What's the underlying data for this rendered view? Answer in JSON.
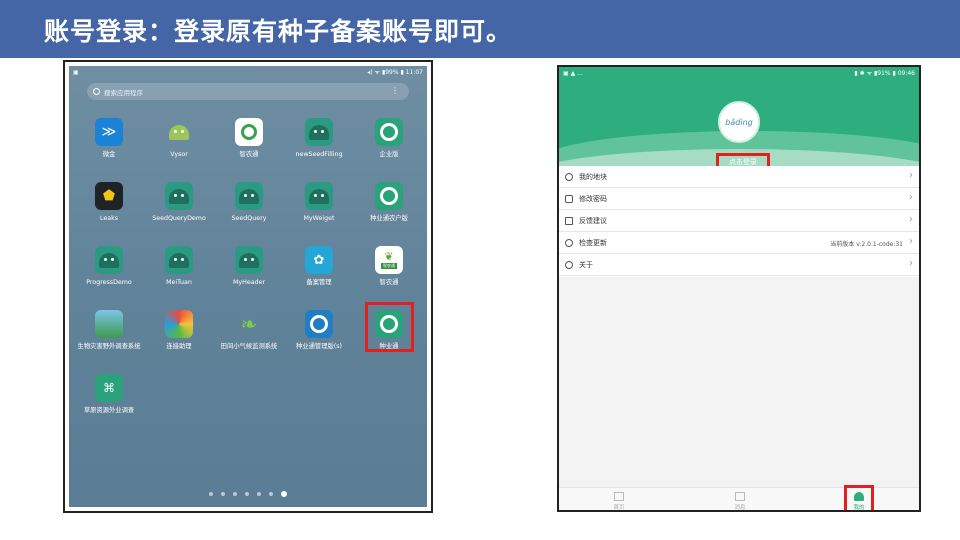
{
  "slide": {
    "title": "账号登录：登录原有种子备案账号即可。"
  },
  "left_phone": {
    "status_left": "▣",
    "status_right": "◂) ᯤ ▮99% ▮ 11:07",
    "search_placeholder": "搜索应用程序",
    "apps": [
      {
        "label": "微金"
      },
      {
        "label": "Vysor"
      },
      {
        "label": "智农通"
      },
      {
        "label": "newSeedFilling"
      },
      {
        "label": "企业版"
      },
      {
        "label": "Leaks"
      },
      {
        "label": "SeedQueryDemo"
      },
      {
        "label": "SeedQuery"
      },
      {
        "label": "MyWeiget"
      },
      {
        "label": "种业通农户版"
      },
      {
        "label": "ProgressDemo"
      },
      {
        "label": "MeiTuan"
      },
      {
        "label": "MyHeader"
      },
      {
        "label": "备案管理"
      },
      {
        "label": "智农通"
      },
      {
        "label": "生物灾害野外调查系统"
      },
      {
        "label": "连接助理"
      },
      {
        "label": "田间小气候监测系统"
      },
      {
        "label": "种业通管理版(s)"
      },
      {
        "label": "种业通"
      },
      {
        "label": "草原资源外业调查"
      }
    ],
    "zhinong_badge": "智农通",
    "pages": 7,
    "active_page": 7
  },
  "right_phone": {
    "status_left": "▣ ▲ ...",
    "status_right": "▮ ✱ ᯤ ▮91% ▮ 09:46",
    "avatar_text": "bǎdìng",
    "login_label": "点击登录",
    "menu": [
      {
        "label": "我的地块"
      },
      {
        "label": "修改密码"
      },
      {
        "label": "反馈建议"
      },
      {
        "label": "检查更新",
        "version": "当前版本 v:2.0.1-code:31"
      },
      {
        "label": "关于"
      }
    ],
    "tabs": [
      {
        "label": "首页"
      },
      {
        "label": "消息"
      },
      {
        "label": "我的"
      }
    ],
    "active_tab": "我的",
    "accent_color": "#2eae7f"
  }
}
